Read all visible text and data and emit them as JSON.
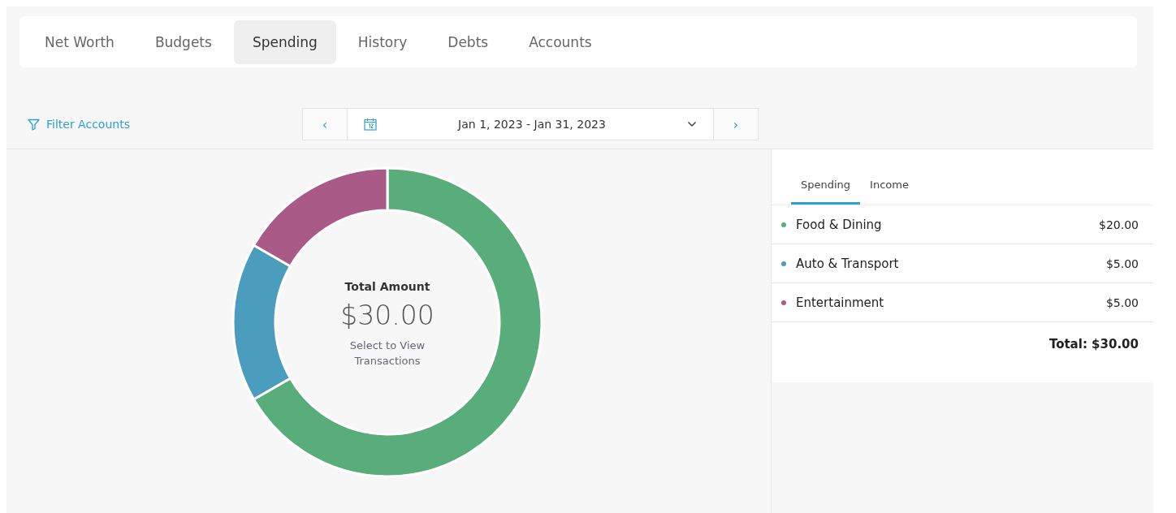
{
  "tabs": [
    {
      "label": "Net Worth",
      "selected": false
    },
    {
      "label": "Budgets",
      "selected": false
    },
    {
      "label": "Spending",
      "selected": true
    },
    {
      "label": "History",
      "selected": false
    },
    {
      "label": "Debts",
      "selected": false
    },
    {
      "label": "Accounts",
      "selected": false
    }
  ],
  "filter": {
    "label": "Filter Accounts"
  },
  "date_range": {
    "prev": "‹",
    "next": "›",
    "value": "Jan 1, 2023 - Jan 31, 2023"
  },
  "donut": {
    "title": "Total Amount",
    "total": "$30.00",
    "hint": "Select to View Transactions",
    "chart_data": {
      "type": "donut",
      "values": [
        66.66,
        16.67,
        16.67
      ]
    }
  },
  "panel_tabs": [
    {
      "label": "Spending",
      "selected": true
    },
    {
      "label": "Income",
      "selected": false
    }
  ],
  "categories": [
    {
      "name": "Food & Dining",
      "amount": "$20.00",
      "color": "#59ad7b"
    },
    {
      "name": "Auto & Transport",
      "amount": "$5.00",
      "color": "#4a9dbd"
    },
    {
      "name": "Entertainment",
      "amount": "$5.00",
      "color": "#a95a87"
    }
  ],
  "total": "Total: $30.00"
}
